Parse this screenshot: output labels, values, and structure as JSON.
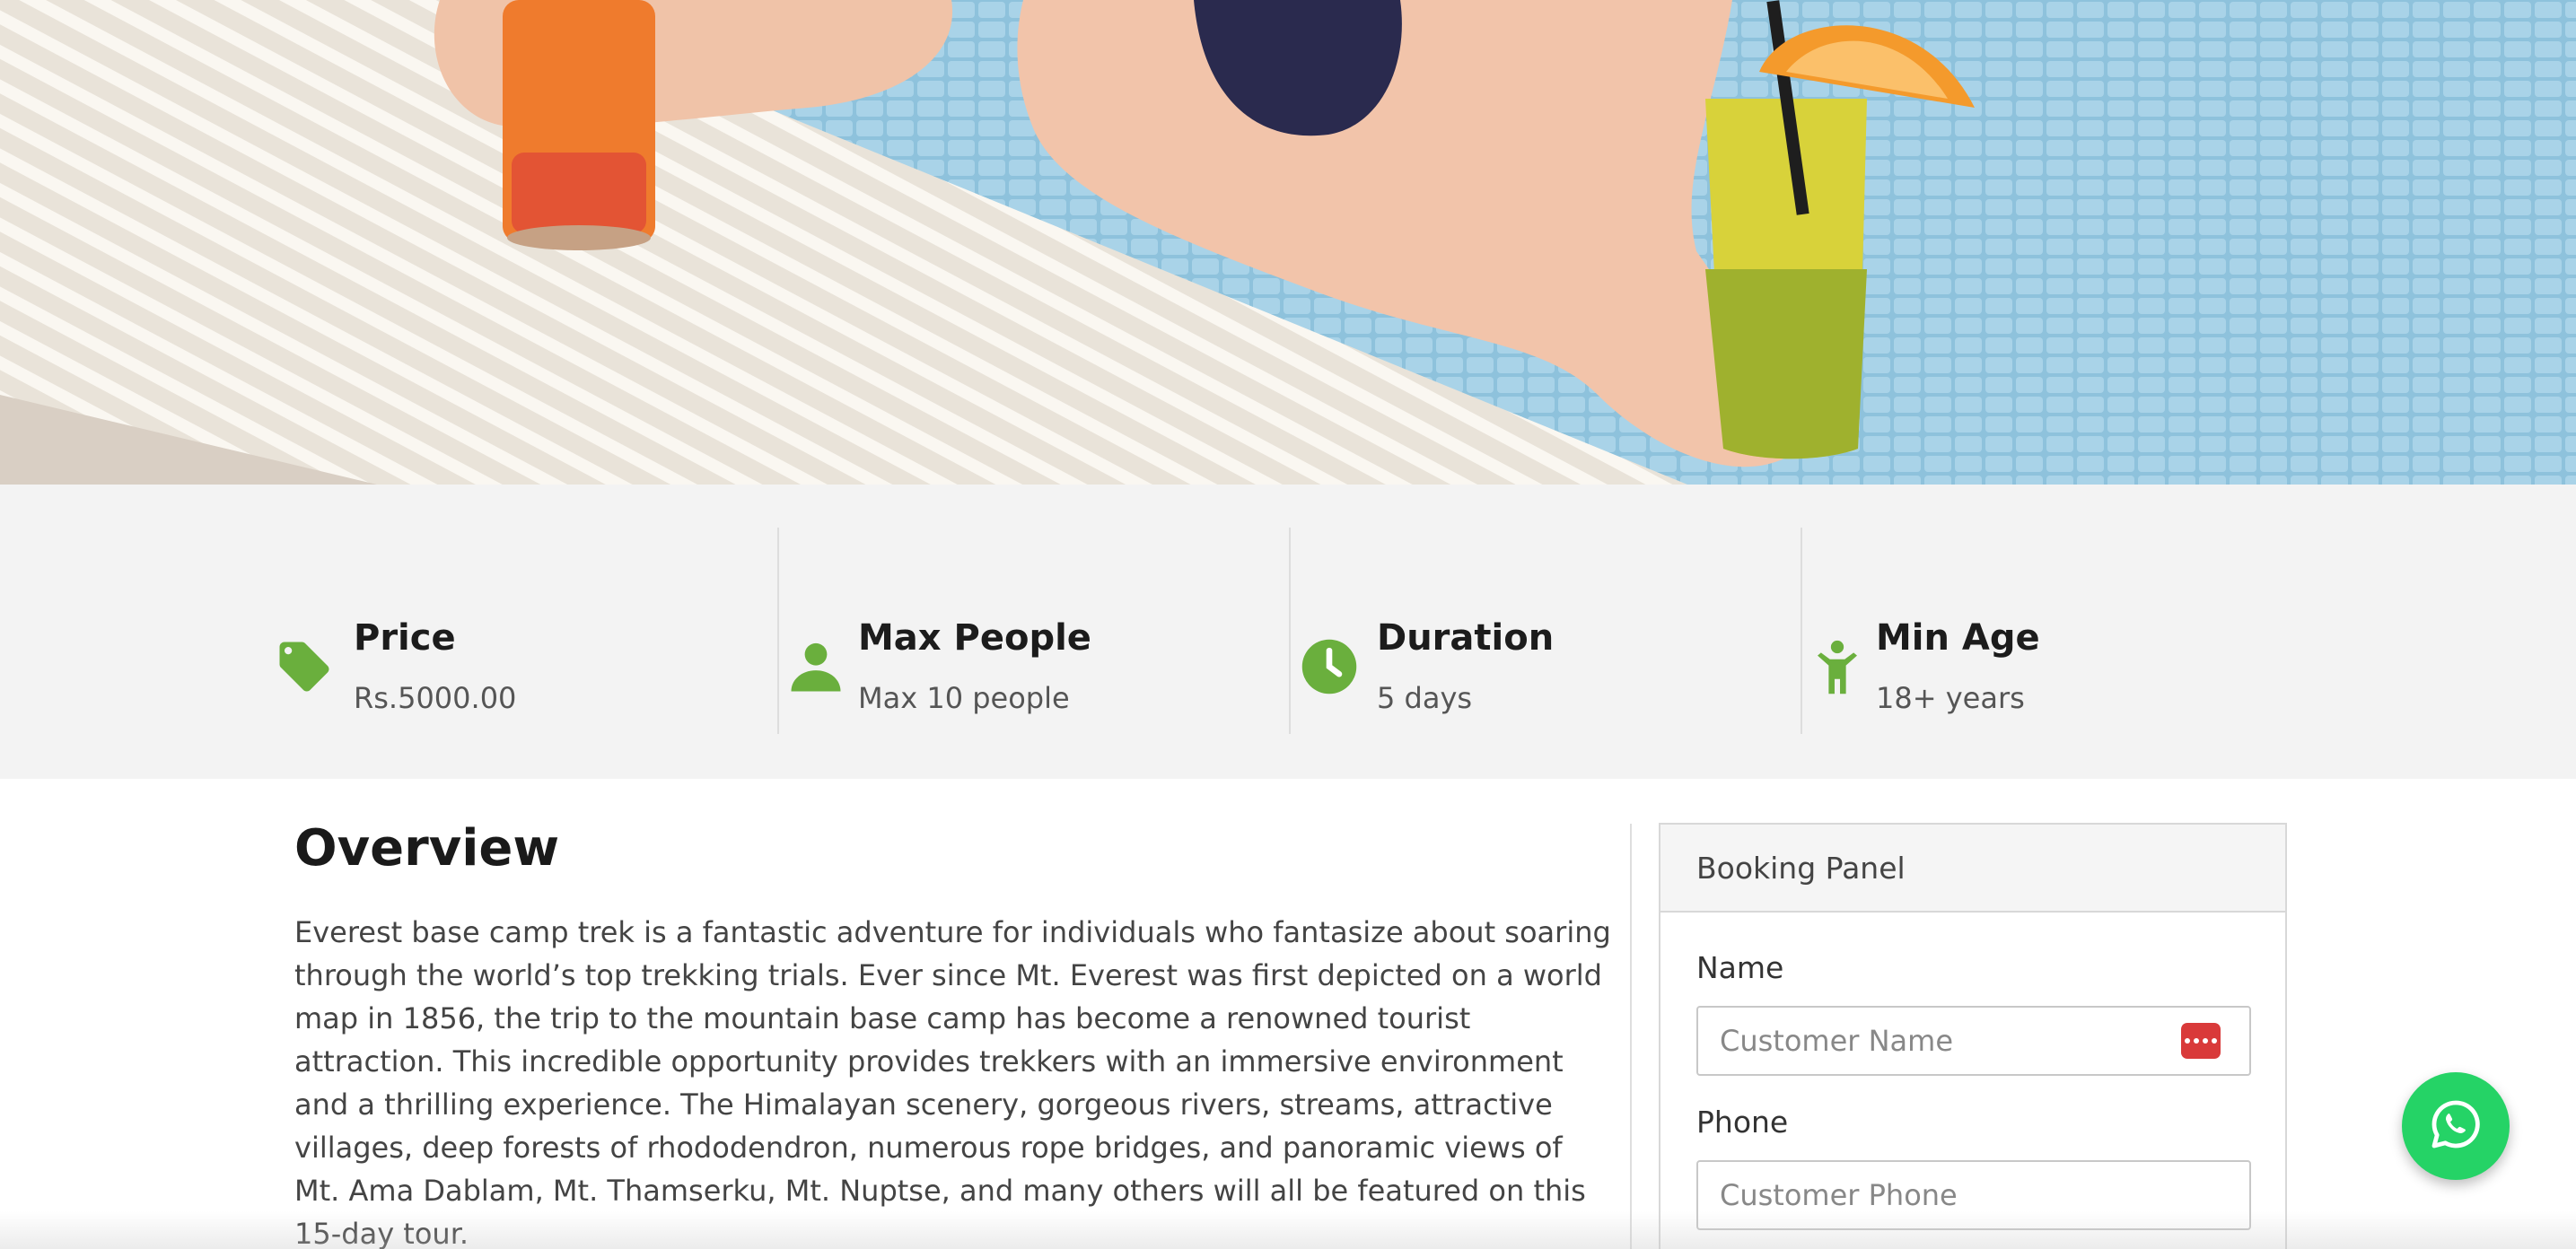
{
  "stats": [
    {
      "title": "Price",
      "value": "Rs.5000.00",
      "icon": "price-tag-icon"
    },
    {
      "title": "Max People",
      "value": "Max 10 people",
      "icon": "person-icon"
    },
    {
      "title": "Duration",
      "value": "5 days",
      "icon": "clock-icon"
    },
    {
      "title": "Min Age",
      "value": "18+ years",
      "icon": "child-icon"
    }
  ],
  "overview": {
    "title": "Overview",
    "text": "Everest base camp trek is a fantastic adventure for individuals who fantasize about soaring through the world’s top trekking trials. Ever since Mt. Everest was first depicted on a world map in 1856, the trip to the mountain base camp has become a renowned tourist attraction. This incredible opportunity provides trekkers with an immersive environment and a thrilling experience. The Himalayan scenery, gorgeous rivers, streams, attractive villages, deep forests of rhododendron, numerous rope bridges, and panoramic views of Mt. Ama Dablam, Mt. Thamserku, Mt. Nuptse, and many others will all be featured on this 15-day tour."
  },
  "booking": {
    "title": "Booking Panel",
    "name_label": "Name",
    "name_placeholder": "Customer Name",
    "name_value": "",
    "phone_label": "Phone",
    "phone_placeholder": "Customer Phone",
    "phone_value": ""
  },
  "colors": {
    "accent": "#6aaf3d",
    "stats_bg": "#f3f3f3",
    "whatsapp": "#25d366",
    "password_manager": "#d93a3a"
  },
  "floating": {
    "icon": "whatsapp-icon"
  },
  "hero": {
    "icon": "pool-drinks-photo"
  }
}
